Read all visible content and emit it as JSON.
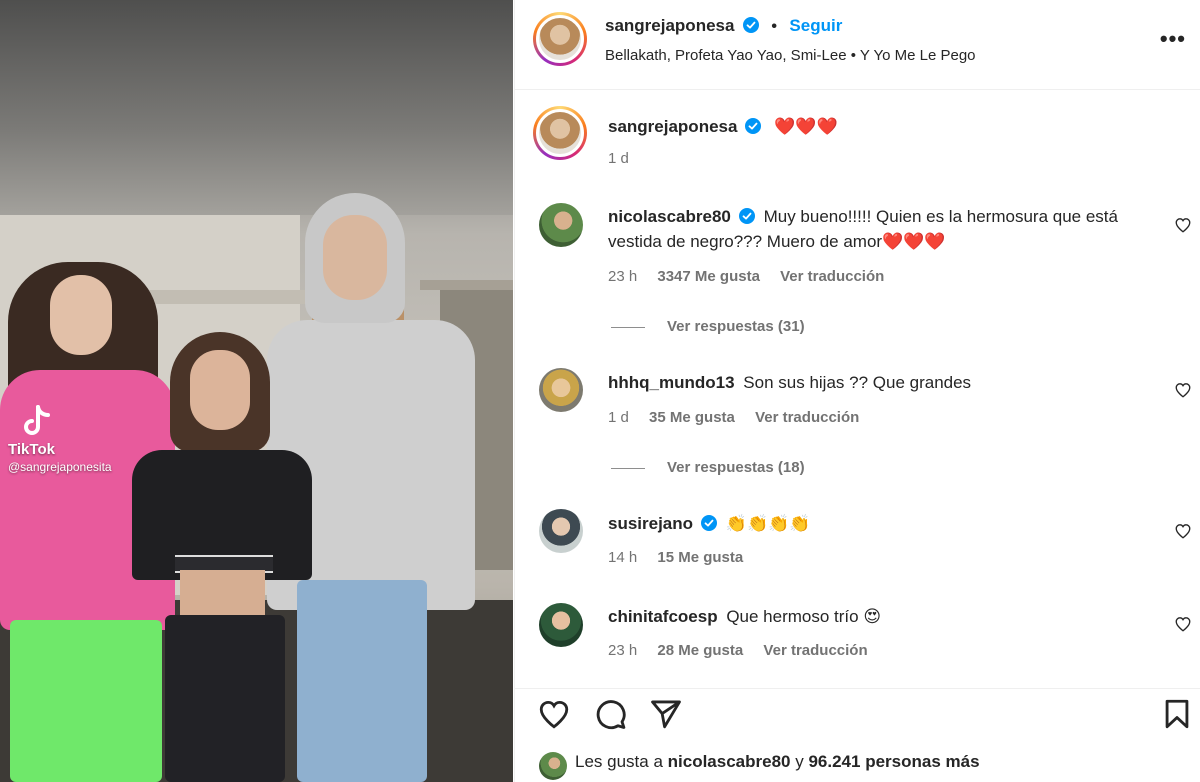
{
  "media": {
    "watermark_brand": "TikTok",
    "watermark_handle": "@sangrejaponesita"
  },
  "header": {
    "username": "sangrejaponesa",
    "separator": "•",
    "follow_label": "Seguir",
    "song_line": "Bellakath, Profeta Yao Yao, Smi-Lee • Y Yo Me Le Pego",
    "more_label": "•••"
  },
  "caption": {
    "username": "sangrejaponesa",
    "text": "❤️❤️❤️",
    "time": "1 d"
  },
  "comments": [
    {
      "username": "nicolascabre80",
      "verified": true,
      "text": "Muy bueno!!!!! Quien es la hermosura que está vestida de negro??? Muero de amor❤️❤️❤️",
      "time": "23 h",
      "likes": "3347 Me gusta",
      "translate": "Ver traducción",
      "replies": "Ver respuestas (31)"
    },
    {
      "username": "hhhq_mundo13",
      "verified": false,
      "text": "Son sus hijas ?? Que grandes",
      "time": "1 d",
      "likes": "35 Me gusta",
      "translate": "Ver traducción",
      "replies": "Ver respuestas (18)"
    },
    {
      "username": "susirejano",
      "verified": true,
      "text": "👏👏👏👏",
      "time": "14 h",
      "likes": "15 Me gusta"
    },
    {
      "username": "chinitafcoesp",
      "verified": false,
      "text": "Que hermoso trío 😍",
      "time": "23 h",
      "likes": "28 Me gusta",
      "translate": "Ver traducción"
    }
  ],
  "likes_summary": {
    "prefix": "Les gusta a",
    "user": "nicolascabre80",
    "conj": "y",
    "count": "96.241 personas más"
  },
  "icons": [
    "heart-icon",
    "comment-icon",
    "share-icon",
    "bookmark-icon",
    "more-icon",
    "verified-icon"
  ],
  "colors": {
    "accent": "#0095f6",
    "text": "#262626",
    "muted": "#737373"
  }
}
